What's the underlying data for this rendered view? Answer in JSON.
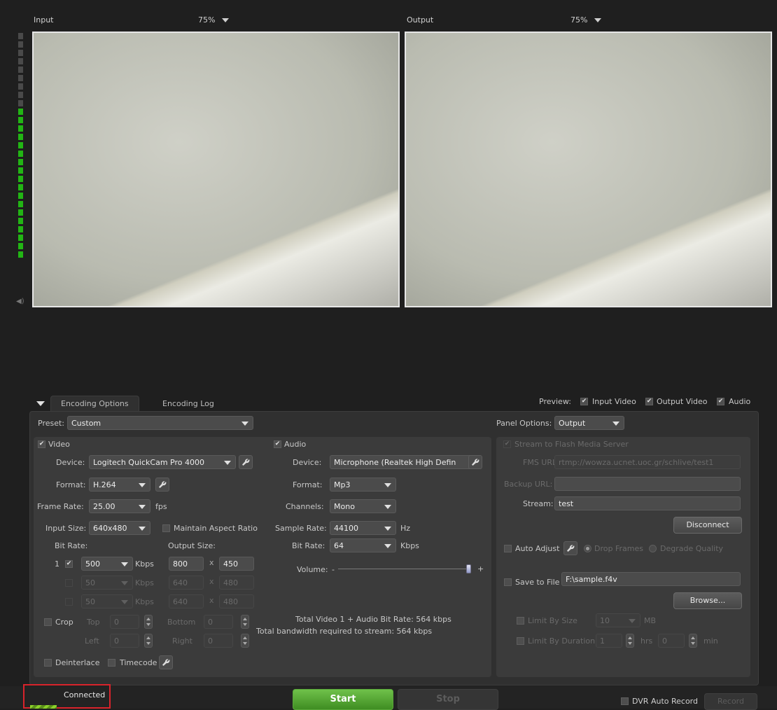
{
  "input_panel": {
    "label": "Input",
    "zoom": "75%"
  },
  "output_panel": {
    "label": "Output",
    "zoom": "75%"
  },
  "tabs": {
    "encoding_options": "Encoding Options",
    "encoding_log": "Encoding Log"
  },
  "preview": {
    "label": "Preview:",
    "input_video": "Input Video",
    "output_video": "Output Video",
    "audio": "Audio",
    "check": "✔"
  },
  "preset": {
    "label": "Preset:",
    "value": "Custom"
  },
  "panel_options": {
    "label": "Panel Options:",
    "value": "Output"
  },
  "video": {
    "header": "Video",
    "device_label": "Device:",
    "device": "Logitech QuickCam Pro 4000",
    "format_label": "Format:",
    "format": "H.264",
    "frame_rate_label": "Frame Rate:",
    "frame_rate": "25.00",
    "fps": "fps",
    "input_size_label": "Input Size:",
    "input_size": "640x480",
    "maintain_aspect": "Maintain Aspect Ratio",
    "bit_rate_label": "Bit Rate:",
    "output_size_label": "Output Size:",
    "rows": [
      {
        "num": "1",
        "bitrate": "500",
        "unit": "Kbps",
        "w": "800",
        "x": "x",
        "h": "450"
      },
      {
        "num": "",
        "bitrate": "50",
        "unit": "Kbps",
        "w": "640",
        "x": "x",
        "h": "480"
      },
      {
        "num": "",
        "bitrate": "50",
        "unit": "Kbps",
        "w": "640",
        "x": "x",
        "h": "480"
      }
    ],
    "crop": "Crop",
    "top": "Top",
    "bottom": "Bottom",
    "left": "Left",
    "right": "Right",
    "crop_top": "0",
    "crop_bottom": "0",
    "crop_left": "0",
    "crop_right": "0",
    "deinterlace": "Deinterlace",
    "timecode": "Timecode"
  },
  "audio": {
    "header": "Audio",
    "device_label": "Device:",
    "device": "Microphone (Realtek High Defin",
    "format_label": "Format:",
    "format": "Mp3",
    "channels_label": "Channels:",
    "channels": "Mono",
    "sample_rate_label": "Sample Rate:",
    "sample_rate": "44100",
    "hz": "Hz",
    "bit_rate_label": "Bit Rate:",
    "bit_rate": "64",
    "kbps": "Kbps",
    "volume_label": "Volume:",
    "minus": "-",
    "plus": "+",
    "volume_level": 1.0,
    "total_video_audio": "Total Video 1 + Audio Bit Rate:  564 kbps",
    "total_bandwidth": "Total bandwidth required to stream:  564 kbps"
  },
  "stream": {
    "header": "Stream to Flash Media Server",
    "fms_label": "FMS URL:",
    "fms_url": "rtmp://wowza.ucnet.uoc.gr/schlive/test1",
    "backup_label": "Backup URL:",
    "backup_url": "",
    "stream_label": "Stream:",
    "stream": "test",
    "disconnect": "Disconnect",
    "auto_adjust": "Auto Adjust",
    "drop_frames": "Drop Frames",
    "degrade_quality": "Degrade Quality",
    "save_to_file": "Save to File",
    "file_path": "F:\\sample.f4v",
    "browse": "Browse...",
    "limit_size": "Limit By Size",
    "size_value": "10",
    "mb": "MB",
    "limit_duration": "Limit By Duration",
    "hrs_value": "1",
    "hrs": "hrs",
    "min_value": "0",
    "min": "min"
  },
  "status": {
    "text": "Connected"
  },
  "controls": {
    "start": "Start",
    "stop": "Stop",
    "dvr_auto_record": "DVR Auto Record",
    "record": "Record"
  },
  "colors": {
    "start_green": "#4f9a2a",
    "meter_green": "#22b514",
    "meter_gray": "#4a4a4a",
    "highlight_red": "#d9232b"
  }
}
